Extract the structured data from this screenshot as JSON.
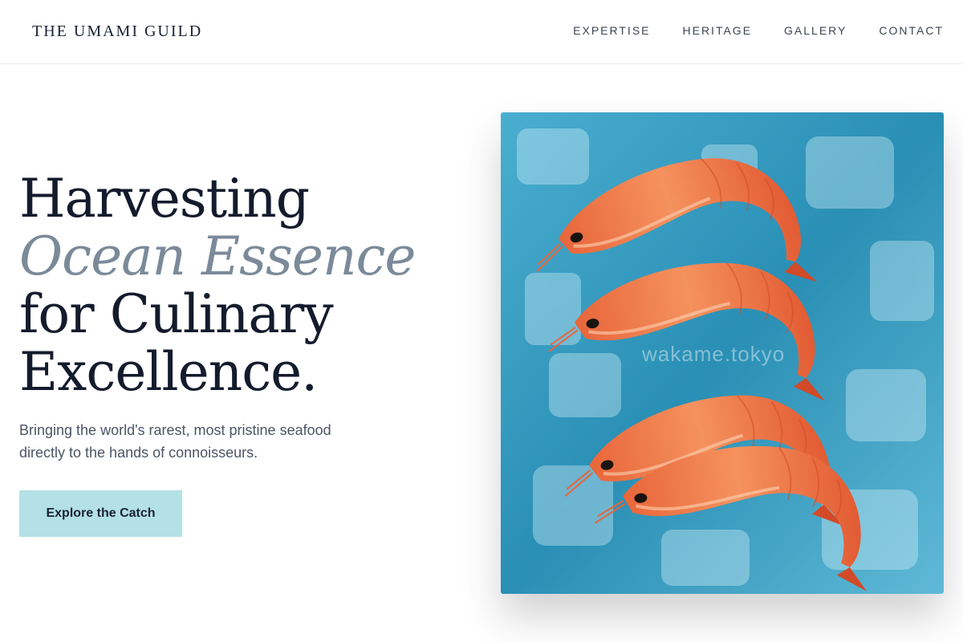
{
  "brand": {
    "name": "THE UMAMI GUILD"
  },
  "nav": {
    "items": [
      "EXPERTISE",
      "HERITAGE",
      "GALLERY",
      "CONTACT"
    ]
  },
  "hero": {
    "headline": [
      "Harvesting",
      "Ocean Essence",
      "for Culinary",
      "Excellence."
    ],
    "subtitle": "Bringing the world's rarest, most pristine seafood directly to the hands of connoisseurs.",
    "cta_label": "Explore the Catch",
    "image": {
      "watermark": "wakame.tokyo",
      "subject": "four shrimp on crushed ice"
    }
  },
  "colors": {
    "text_dark": "#141b2d",
    "accent_italic": "#7b8a99",
    "cta_bg": "#b3e1e6",
    "ice_blue": "#2a8fb5",
    "shrimp_orange": "#f07a45"
  }
}
